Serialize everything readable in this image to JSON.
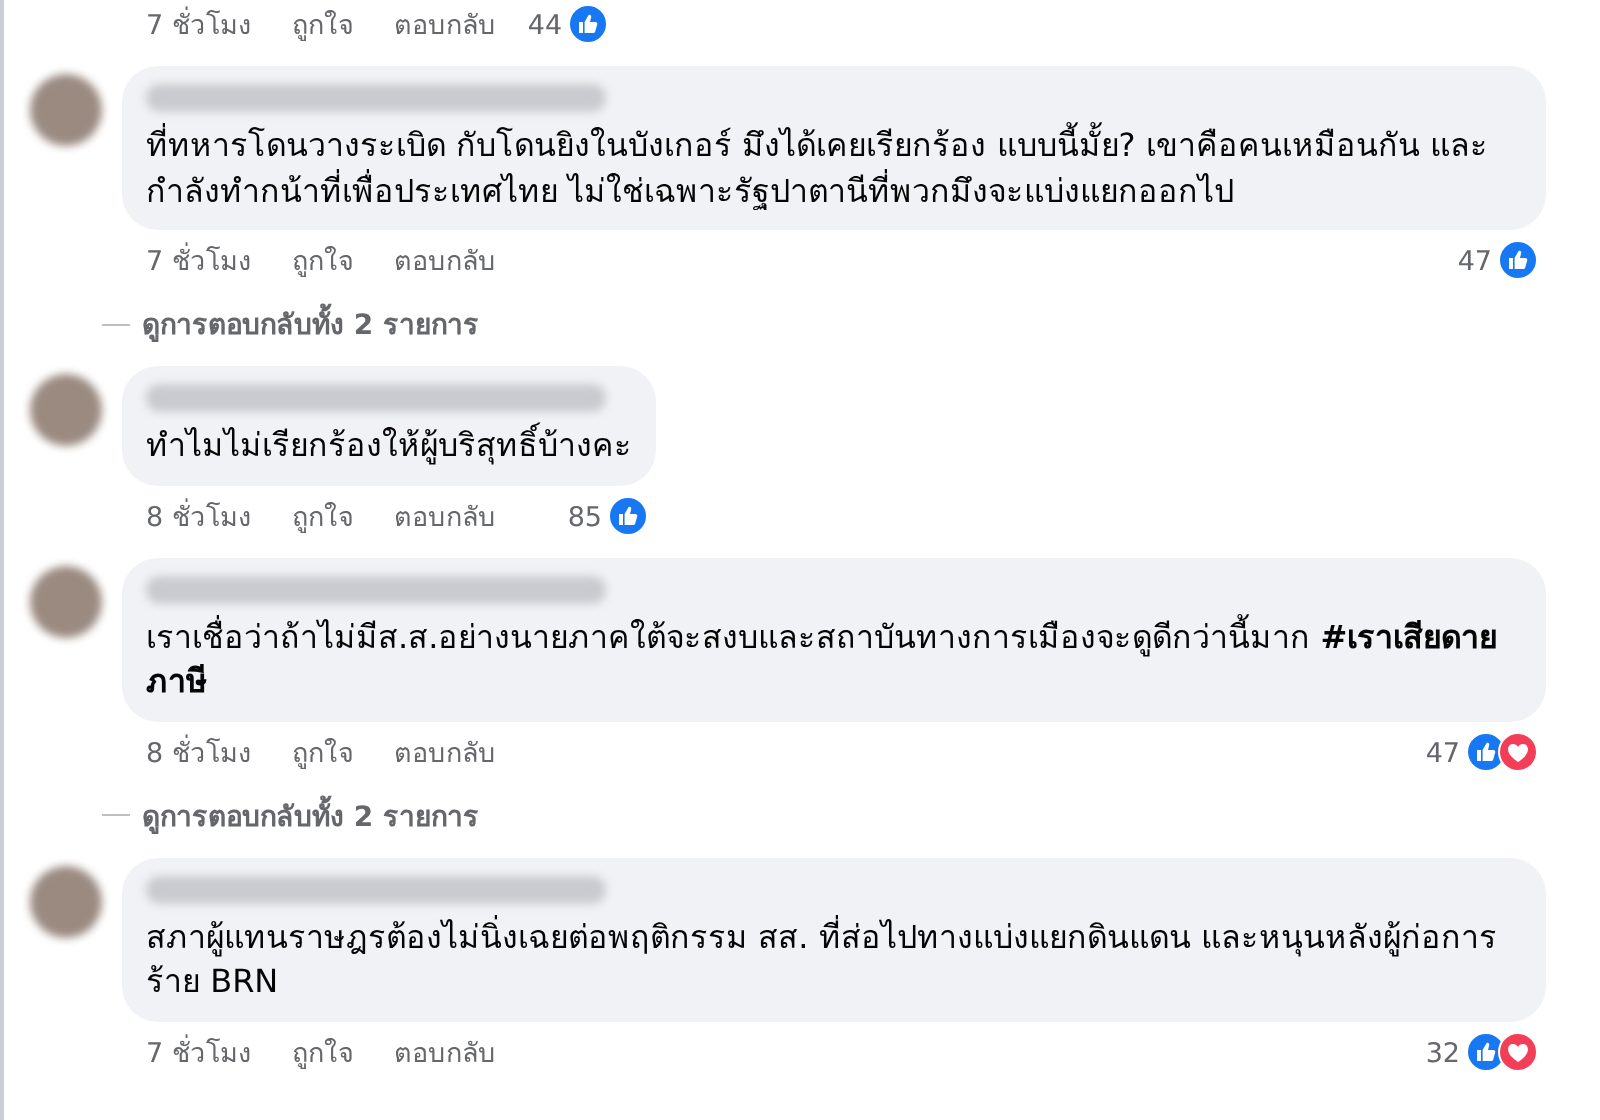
{
  "top_actions": {
    "time": "7 ชั่วโมง",
    "like": "ถูกใจ",
    "reply": "ตอบกลับ",
    "count": "44",
    "reactions": {
      "like": true,
      "love": false
    }
  },
  "comments": [
    {
      "text": "ที่ทหารโดนวางระเบิด กับโดนยิงในบังเกอร์ มึงได้เคยเรียกร้อง แบบนี้มั้ย? เขาคือคนเหมือนกัน และกำลังทำกน้าที่เพื่อประเทศไทย ไม่ใช่เฉพาะรัฐปาตานีที่พวกมึงจะแบ่งแยกออกไป",
      "time": "7 ชั่วโมง",
      "like": "ถูกใจ",
      "reply": "ตอบกลับ",
      "count": "47",
      "reactions": {
        "like": true,
        "love": false
      },
      "view_replies": "ดูการตอบกลับทั้ง 2 รายการ"
    },
    {
      "text": "ทำไมไม่เรียกร้องให้ผู้บริสุทธิ์บ้างคะ",
      "time": "8 ชั่วโมง",
      "like": "ถูกใจ",
      "reply": "ตอบกลับ",
      "count": "85",
      "reactions": {
        "like": true,
        "love": false
      }
    },
    {
      "text": "เราเชื่อว่าถ้าไม่มีส.ส.อย่างนายภาคใต้จะสงบและสถาบันทางการเมืองจะดูดีกว่านี้มาก **#เราเสียดายภาษี**",
      "time": "8 ชั่วโมง",
      "like": "ถูกใจ",
      "reply": "ตอบกลับ",
      "count": "47",
      "reactions": {
        "like": true,
        "love": true
      },
      "view_replies": "ดูการตอบกลับทั้ง 2 รายการ"
    },
    {
      "text": "สภาผู้แทนราษฎรต้องไม่นิ่งเฉยต่อพฤติกรรม สส. ที่ส่อไปทางแบ่งแยกดินแดน และหนุนหลังผู้ก่อการร้าย BRN",
      "time": "7 ชั่วโมง",
      "like": "ถูกใจ",
      "reply": "ตอบกลับ",
      "count": "32",
      "reactions": {
        "like": true,
        "love": true
      }
    }
  ]
}
